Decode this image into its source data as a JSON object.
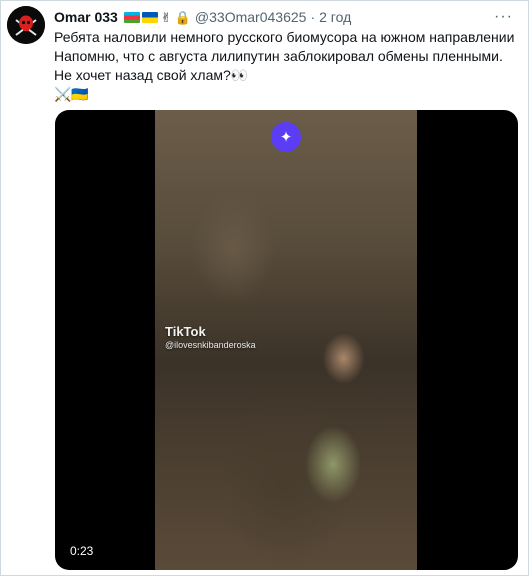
{
  "tweet": {
    "author_name": "Omar 033",
    "handle": "@33Omar043625",
    "separator": "·",
    "time": "2 год",
    "lines": [
      "Ребята наловили немного русского биомусора на южном направлении",
      "Напомню, что с августа лилипутин заблокировал обмены пленными. Не хочет назад свой хлам?👀"
    ],
    "emoji_line": "⚔️🇺🇦"
  },
  "media": {
    "watermark": "TikTok",
    "watermark_user": "@ilovesnkibanderoska",
    "duration": "0:23"
  },
  "icons": {
    "more": "more-horizontal-icon",
    "sparkle": "sparkle-icon",
    "lock": "lock-icon",
    "victory": "victory-hand-icon"
  },
  "colors": {
    "accent": "#5b3df5",
    "muted": "#536471",
    "border": "#cfd9de"
  }
}
